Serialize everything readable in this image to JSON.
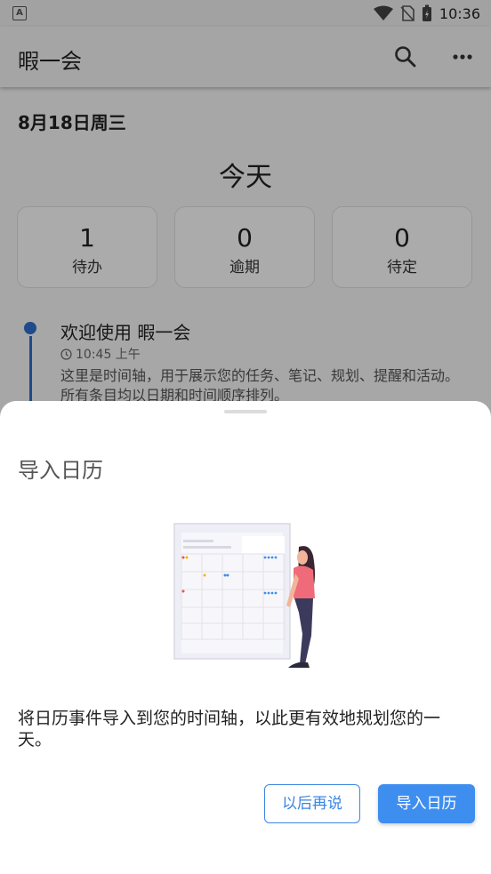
{
  "status_bar": {
    "time": "10:36",
    "left_icon": "A"
  },
  "app_bar": {
    "title": "暇一会"
  },
  "header": {
    "date": "8月18日周三",
    "today": "今天"
  },
  "stats": [
    {
      "value": "1",
      "label": "待办"
    },
    {
      "value": "0",
      "label": "逾期"
    },
    {
      "value": "0",
      "label": "待定"
    }
  ],
  "timeline": {
    "item_title": "欢迎使用 暇一会",
    "item_time": "10:45 上午",
    "item_desc": "这里是时间轴，用于展示您的任务、笔记、规划、提醒和活动。所有条目均以日期和时间顺序排列。"
  },
  "sheet": {
    "title": "导入日历",
    "description": "将日历事件导入到您的时间轴，以此更有效地规划您的一天。",
    "later_button": "以后再说",
    "import_button": "导入日历"
  },
  "colors": {
    "accent": "#3e8ef0",
    "timeline": "#2f6fcf",
    "figure_shirt": "#f06b7a",
    "figure_pants": "#3c3a5c"
  }
}
